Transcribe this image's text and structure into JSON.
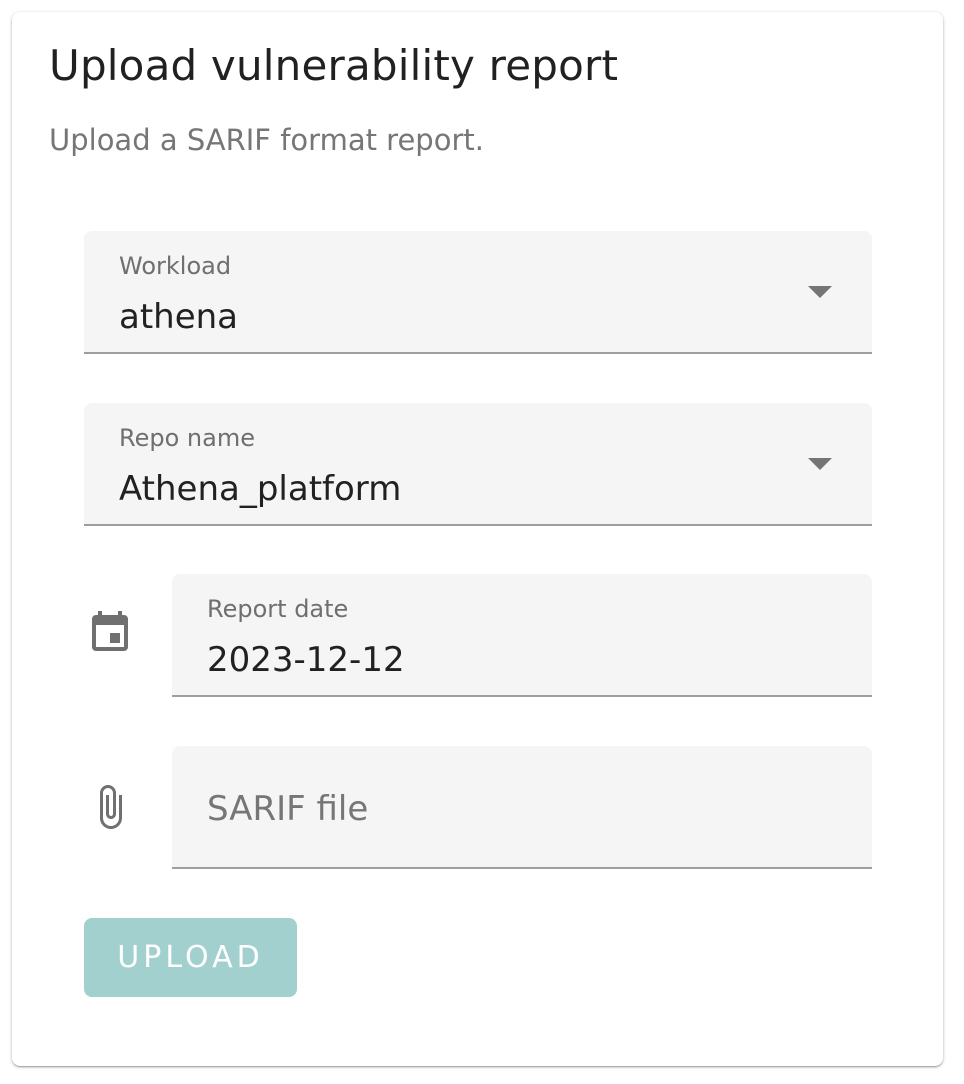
{
  "card": {
    "title": "Upload vulnerability report",
    "subtitle": "Upload a SARIF format report."
  },
  "form": {
    "workload": {
      "label": "Workload",
      "value": "athena",
      "icon": "chevron-down-icon"
    },
    "repo_name": {
      "label": "Repo name",
      "value": "Athena_platform",
      "icon": "chevron-down-icon"
    },
    "report_date": {
      "label": "Report date",
      "value": "2023-12-12",
      "icon": "calendar-icon"
    },
    "sarif_file": {
      "placeholder": "SARIF file",
      "icon": "paperclip-icon"
    }
  },
  "actions": {
    "upload_label": "UPLOAD",
    "upload_color": "#a2d0cf"
  }
}
